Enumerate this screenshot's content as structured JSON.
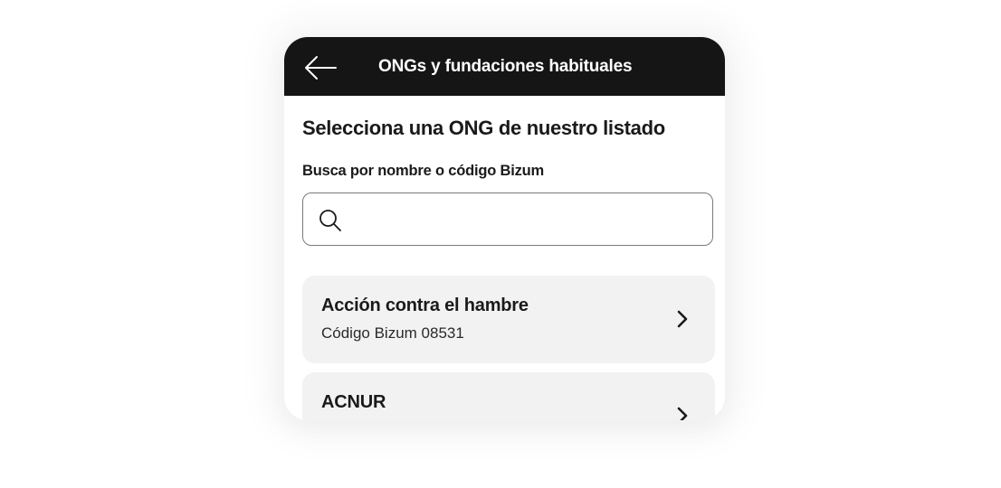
{
  "header": {
    "back_icon": "arrow-left-icon",
    "title": "ONGs y fundaciones habituales"
  },
  "main": {
    "section_title": "Selecciona una ONG de nuestro listado",
    "search": {
      "label": "Busca por nombre o código Bizum",
      "icon": "search-icon",
      "value": "",
      "placeholder": ""
    },
    "ngos": [
      {
        "name": "Acción contra el hambre",
        "code": "Código Bizum 08531",
        "icon": "chevron-right-icon"
      },
      {
        "name": "ACNUR",
        "code": "",
        "icon": "chevron-right-icon"
      }
    ]
  },
  "colors": {
    "header_bg": "#151515",
    "card_bg": "#f2f2f2",
    "text": "#1a1a1a"
  }
}
